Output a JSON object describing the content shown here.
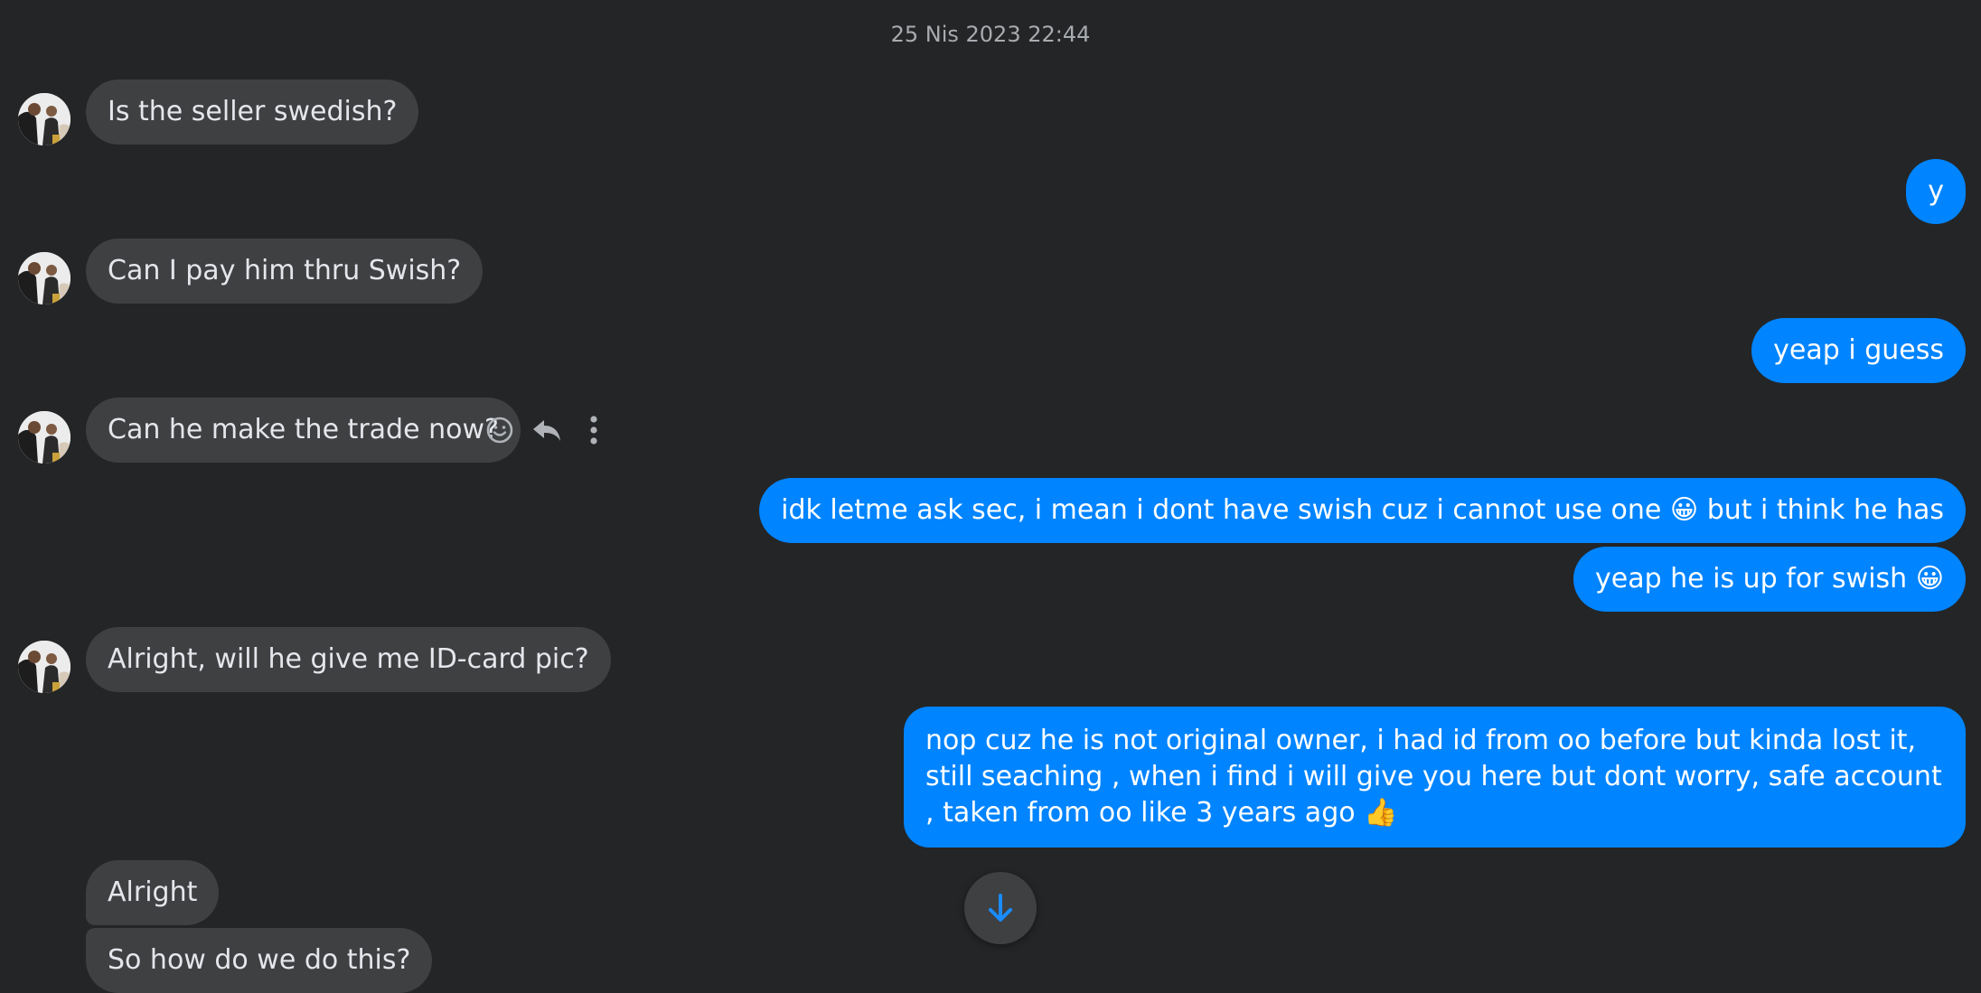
{
  "header": {
    "timestamp": "25 Nis 2023 22:44"
  },
  "messages": [
    {
      "text": "Is the seller swedish?"
    },
    {
      "text": "y"
    },
    {
      "text": "Can I pay him thru Swish?"
    },
    {
      "text": "yeap i guess"
    },
    {
      "text": "Can he make the trade now?"
    },
    {
      "text": "idk letme ask sec, i mean i dont have swish cuz i cannot use one 😀 but i think he has"
    },
    {
      "text": "yeap he is up for swish 😀"
    },
    {
      "text": "Alright, will he give me ID-card pic?"
    },
    {
      "text": "nop cuz he is not original owner, i had id from oo before but kinda lost it, still seaching , when i find i will give you here but dont worry, safe account , taken from oo like 3 years ago 👍"
    },
    {
      "text": "Alright"
    },
    {
      "text": "So how do we do this?"
    }
  ],
  "message_actions": {
    "icons": [
      "emoji-icon",
      "reply-icon",
      "more-options-icon"
    ]
  },
  "scroll_button": {
    "icon": "arrow-down-icon"
  },
  "colors": {
    "background": "#242526",
    "incoming_bubble": "#3e4042",
    "outgoing_bubble": "#0084ff",
    "incoming_text": "#e4e6eb",
    "timestamp_text": "#a8abaf"
  }
}
